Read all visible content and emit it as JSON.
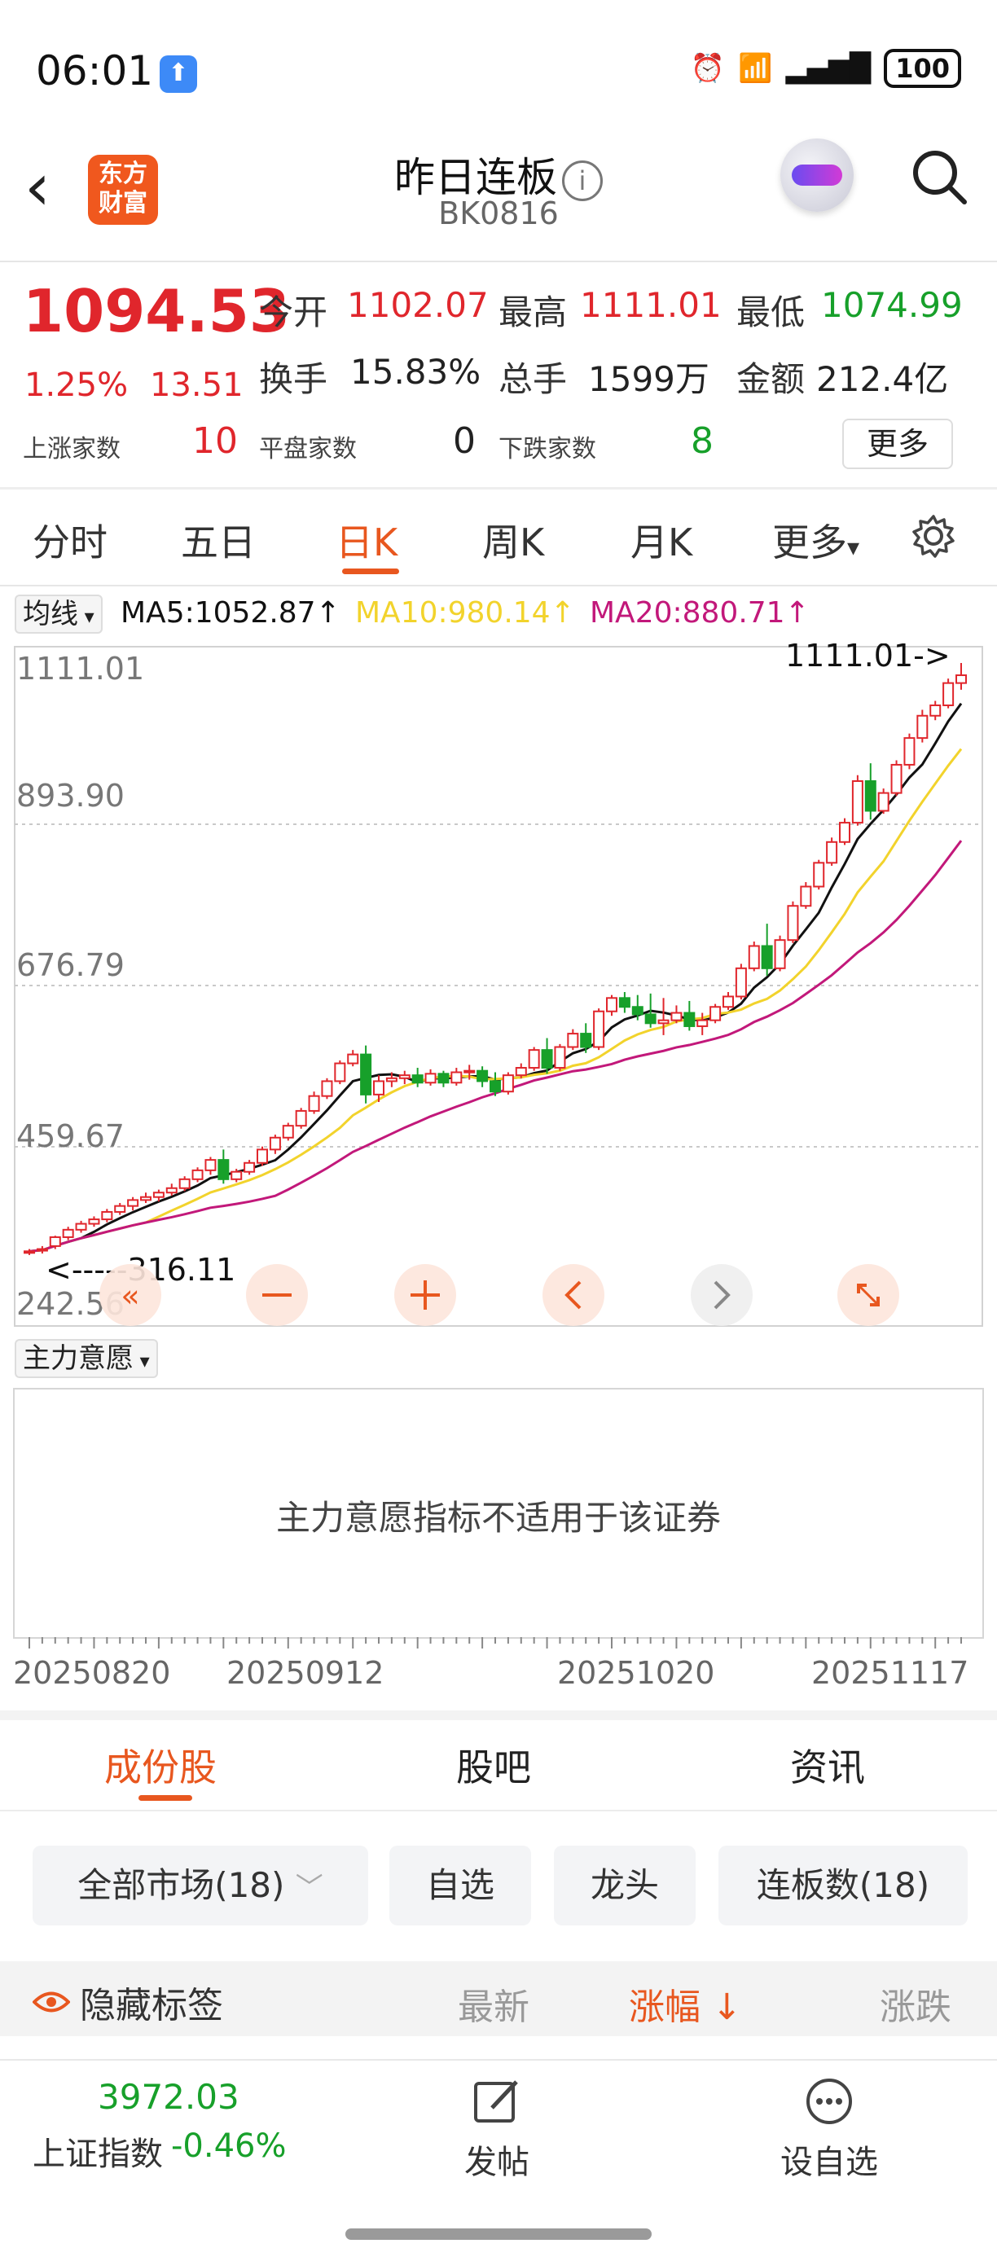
{
  "status_bar": {
    "time": "06:01",
    "battery": "100"
  },
  "header": {
    "logo_line1": "东方",
    "logo_line2": "财富",
    "title": "昨日连板",
    "code": "BK0816"
  },
  "quote": {
    "price": "1094.53",
    "pct_change": "1.25%",
    "change": "13.51",
    "open_label": "今开",
    "open": "1102.07",
    "high_label": "最高",
    "high": "1111.01",
    "low_label": "最低",
    "low": "1074.99",
    "turnover_label": "换手",
    "turnover": "15.83%",
    "volume_label": "总手",
    "volume": "1599万",
    "amount_label": "金额",
    "amount": "212.4亿",
    "up_label": "上涨家数",
    "up": "10",
    "flat_label": "平盘家数",
    "flat": "0",
    "down_label": "下跌家数",
    "down": "8",
    "more": "更多"
  },
  "period_tabs": {
    "t1": "分时",
    "t2": "五日",
    "t3": "日K",
    "t4": "周K",
    "t5": "月K",
    "t6": "更多"
  },
  "ma": {
    "select": "均线",
    "ma5": "MA5:1052.87↑",
    "ma10": "MA10:980.14↑",
    "ma20": "MA20:880.71↑"
  },
  "chart_data": {
    "type": "candlestick",
    "y_ticks": [
      "1111.01",
      "893.90",
      "676.79",
      "459.67",
      "242.56"
    ],
    "max_annotation": "1111.01->",
    "min_annotation": "<-----316.11",
    "x_ticks": [
      "20250820",
      "20250912",
      "20251020",
      "20251117"
    ],
    "ylim": [
      242.56,
      1111.01
    ],
    "candles": [
      [
        318,
        322,
        314,
        319
      ],
      [
        320,
        326,
        316,
        322
      ],
      [
        326,
        340,
        322,
        338
      ],
      [
        338,
        352,
        334,
        348
      ],
      [
        348,
        360,
        344,
        356
      ],
      [
        356,
        366,
        352,
        362
      ],
      [
        362,
        376,
        358,
        372
      ],
      [
        372,
        384,
        368,
        380
      ],
      [
        380,
        392,
        374,
        388
      ],
      [
        388,
        398,
        384,
        392
      ],
      [
        392,
        402,
        386,
        398
      ],
      [
        398,
        410,
        394,
        404
      ],
      [
        404,
        420,
        400,
        416
      ],
      [
        416,
        432,
        412,
        428
      ],
      [
        428,
        446,
        422,
        442
      ],
      [
        442,
        456,
        410,
        416
      ],
      [
        416,
        430,
        412,
        426
      ],
      [
        426,
        442,
        422,
        438
      ],
      [
        438,
        460,
        434,
        456
      ],
      [
        456,
        476,
        450,
        472
      ],
      [
        472,
        492,
        468,
        488
      ],
      [
        488,
        512,
        484,
        508
      ],
      [
        508,
        534,
        504,
        528
      ],
      [
        528,
        552,
        524,
        548
      ],
      [
        548,
        576,
        544,
        572
      ],
      [
        572,
        590,
        568,
        584
      ],
      [
        584,
        596,
        518,
        530
      ],
      [
        530,
        556,
        520,
        548
      ],
      [
        548,
        560,
        540,
        552
      ],
      [
        552,
        562,
        544,
        556
      ],
      [
        556,
        566,
        540,
        546
      ],
      [
        546,
        564,
        542,
        558
      ],
      [
        558,
        562,
        540,
        546
      ],
      [
        546,
        566,
        542,
        560
      ],
      [
        560,
        570,
        550,
        562
      ],
      [
        562,
        568,
        540,
        548
      ],
      [
        548,
        560,
        528,
        534
      ],
      [
        534,
        560,
        530,
        556
      ],
      [
        556,
        572,
        552,
        566
      ],
      [
        566,
        594,
        562,
        590
      ],
      [
        590,
        606,
        558,
        566
      ],
      [
        566,
        598,
        562,
        594
      ],
      [
        594,
        618,
        590,
        612
      ],
      [
        612,
        626,
        586,
        594
      ],
      [
        594,
        646,
        590,
        642
      ],
      [
        642,
        664,
        636,
        660
      ],
      [
        660,
        668,
        640,
        648
      ],
      [
        648,
        664,
        630,
        638
      ],
      [
        638,
        666,
        620,
        626
      ],
      [
        626,
        660,
        610,
        630
      ],
      [
        630,
        650,
        626,
        640
      ],
      [
        640,
        656,
        616,
        622
      ],
      [
        622,
        640,
        610,
        630
      ],
      [
        630,
        652,
        626,
        648
      ],
      [
        648,
        668,
        644,
        662
      ],
      [
        662,
        706,
        658,
        700
      ],
      [
        700,
        736,
        696,
        730
      ],
      [
        730,
        760,
        690,
        700
      ],
      [
        700,
        744,
        696,
        738
      ],
      [
        738,
        790,
        734,
        784
      ],
      [
        784,
        816,
        780,
        810
      ],
      [
        810,
        846,
        806,
        842
      ],
      [
        842,
        876,
        838,
        870
      ],
      [
        870,
        902,
        866,
        896
      ],
      [
        896,
        960,
        892,
        952
      ],
      [
        952,
        976,
        900,
        912
      ],
      [
        912,
        942,
        908,
        936
      ],
      [
        936,
        980,
        932,
        974
      ],
      [
        974,
        1016,
        968,
        1010
      ],
      [
        1010,
        1048,
        1004,
        1040
      ],
      [
        1040,
        1060,
        1034,
        1054
      ],
      [
        1054,
        1090,
        1050,
        1084
      ],
      [
        1084,
        1111.01,
        1074.99,
        1094.53
      ]
    ]
  },
  "indicator": {
    "select": "主力意愿",
    "message": "主力意愿指标不适用于该证券"
  },
  "sub_tabs": {
    "t1": "成份股",
    "t2": "股吧",
    "t3": "资讯"
  },
  "chips": {
    "c1": "全部市场(18)",
    "c2": "自选",
    "c3": "龙头",
    "c4": "连板数(18)"
  },
  "list_header": {
    "hide_tags": "隐藏标签",
    "latest": "最新",
    "pct": "涨幅 ↓",
    "chg": "涨跌"
  },
  "bottom": {
    "index_value": "3972.03",
    "index_name": "上证指数",
    "index_change": "-0.46%",
    "post": "发帖",
    "watch": "设自选"
  },
  "colors": {
    "up": "#e0262c",
    "down": "#17a02a",
    "accent": "#e8571f",
    "ma5": "#111111",
    "ma10": "#f2d32c",
    "ma20": "#c2187a"
  }
}
